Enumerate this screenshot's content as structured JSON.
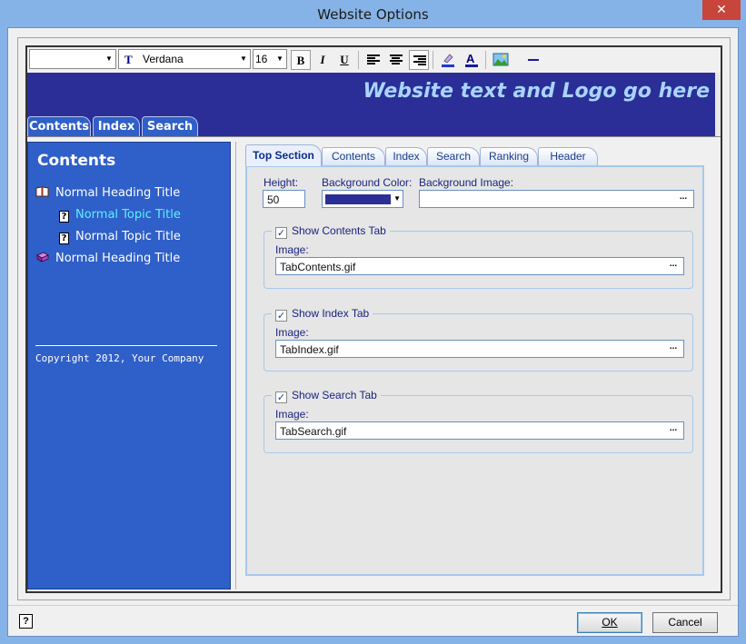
{
  "window": {
    "title": "Website Options",
    "close_glyph": "✕"
  },
  "toolbar": {
    "style_combo_value": "",
    "font_combo_value": "Verdana",
    "size_combo_value": "16",
    "bold_label": "B",
    "italic_label": "I",
    "underline_label": "U"
  },
  "banner": {
    "text": "Website text and Logo go here",
    "background_color": "#2b2e96",
    "text_color": "#a8d4ff",
    "tabs": [
      {
        "label": "Contents"
      },
      {
        "label": "Index"
      },
      {
        "label": "Search"
      }
    ]
  },
  "contents_panel": {
    "title": "Contents",
    "items": [
      {
        "label": "Normal Heading Title",
        "type": "heading-open"
      },
      {
        "label": "Normal Topic Title",
        "type": "topic",
        "active": true
      },
      {
        "label": "Normal Topic Title",
        "type": "topic"
      },
      {
        "label": "Normal Heading Title",
        "type": "heading-closed"
      }
    ],
    "topic_icon_glyph": "?",
    "copyright": "Copyright 2012, Your Company",
    "background_color": "#2f5fc8",
    "active_color": "#5ef0ff"
  },
  "options": {
    "tabs": [
      {
        "label": "Top Section",
        "selected": true
      },
      {
        "label": "Contents"
      },
      {
        "label": "Index"
      },
      {
        "label": "Search"
      },
      {
        "label": "Ranking"
      },
      {
        "label": "Header"
      }
    ],
    "height_label": "Height:",
    "height_value": "50",
    "bg_color_label": "Background Color:",
    "bg_color_value": "#2b2e96",
    "bg_image_label": "Background Image:",
    "bg_image_value": "",
    "browse_glyph": "...",
    "check_glyph": "✓",
    "groups": [
      {
        "legend": "Show Contents Tab",
        "checked": true,
        "image_label": "Image:",
        "image_value": "TabContents.gif"
      },
      {
        "legend": "Show Index Tab",
        "checked": true,
        "image_label": "Image:",
        "image_value": "TabIndex.gif"
      },
      {
        "legend": "Show Search Tab",
        "checked": true,
        "image_label": "Image:",
        "image_value": "TabSearch.gif"
      }
    ]
  },
  "footer": {
    "help_glyph": "?",
    "ok_label": "OK",
    "cancel_label": "Cancel"
  }
}
